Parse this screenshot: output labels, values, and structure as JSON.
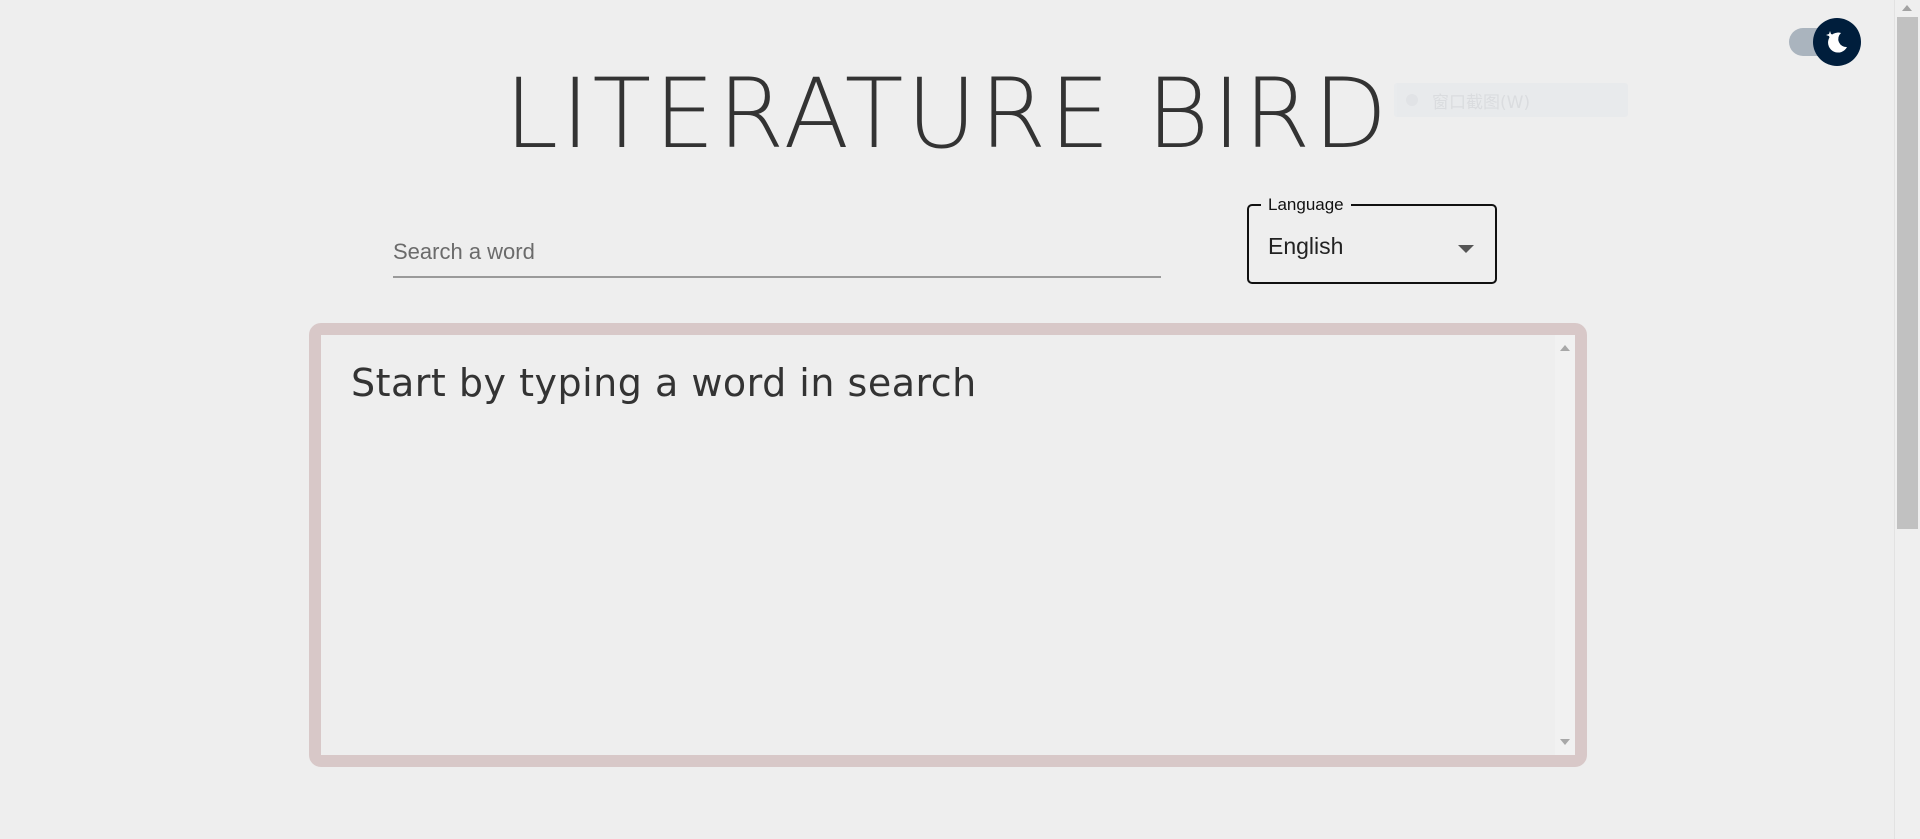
{
  "app": {
    "title": "LITERATURE BIRD"
  },
  "theme_toggle": {
    "icon": "moon-icon",
    "state": "dark",
    "track_color": "#aab4be",
    "thumb_color": "#001e3c"
  },
  "ghost_widget": {
    "label": "窗口截图(W)"
  },
  "search": {
    "placeholder": "Search a word",
    "value": ""
  },
  "language": {
    "label": "Language",
    "selected": "English"
  },
  "results": {
    "message": "Start by typing a word in search"
  },
  "colors": {
    "background": "#eeeeee",
    "panel_border": "#d8c8c8",
    "text": "#333333"
  }
}
